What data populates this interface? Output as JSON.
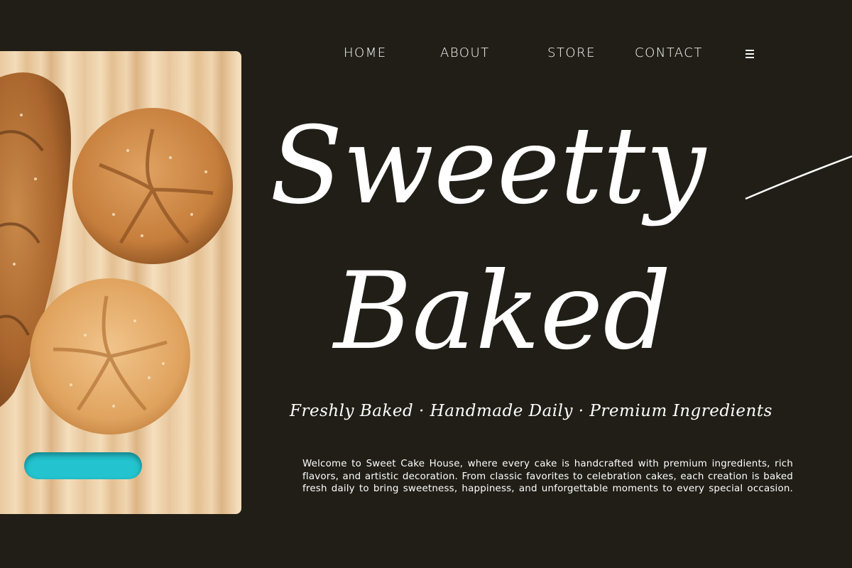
{
  "nav": {
    "home": "HOME",
    "about": "ABOUT",
    "store": "STORE",
    "contact": "CONTACT",
    "menu_icon": "hamburger-menu-icon"
  },
  "hero": {
    "title_line1": "Sweetty",
    "title_line2": "Baked",
    "tagline": "Freshly Baked · Handmade Daily · Premium Ingredients",
    "intro": "Welcome to Sweet Cake House, where every cake is handcrafted with premium ingredients, rich flavors, and artistic decoration. From classic favorites to celebration cakes, each creation is baked fresh daily to bring sweetness, happiness, and unforgettable moments to every special occasion."
  },
  "colors": {
    "background": "#211e17",
    "text": "#ffffff",
    "board_handle": "#23c3cf"
  }
}
